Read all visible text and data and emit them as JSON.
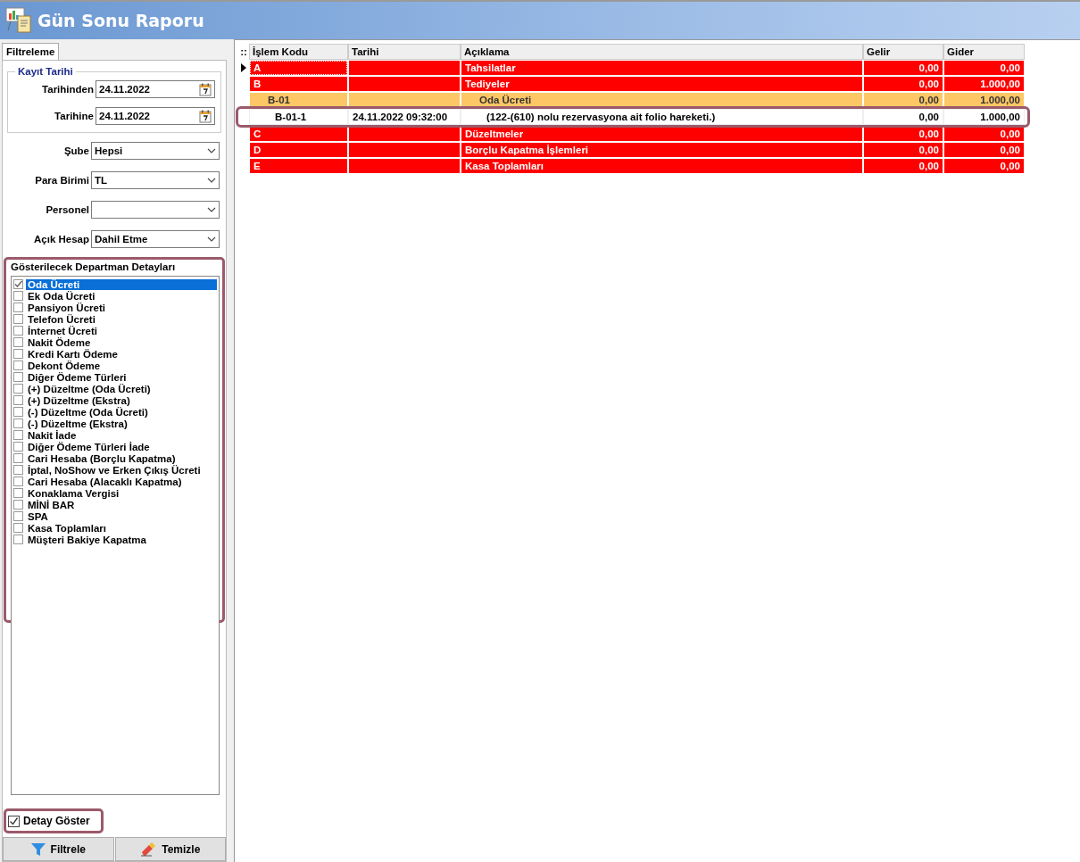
{
  "window": {
    "title": "Gün Sonu Raporu"
  },
  "filter_panel": {
    "tab": {
      "label": "Filtreleme",
      "selected": true
    },
    "date_group": {
      "title": "Kayıt Tarihi",
      "fields": [
        {
          "label": "Tarihinden",
          "value": "24.11.2022"
        },
        {
          "label": "Tarihine",
          "value": "24.11.2022"
        }
      ]
    },
    "dropdowns": [
      {
        "label": "Şube",
        "value": "Hepsi"
      },
      {
        "label": "Para Birimi",
        "value": "TL"
      },
      {
        "label": "Personel"
      },
      {
        "label": "Açık Hesap",
        "value": "Dahil Etme"
      }
    ],
    "department_list": {
      "title": "Gösterilecek Departman Detayları",
      "items": [
        {
          "label": "Oda Ücreti",
          "checked": true,
          "selected": true
        },
        {
          "label": "Ek Oda Ücreti",
          "checked": false,
          "selected": false
        },
        {
          "label": "Pansiyon Ücreti",
          "checked": false,
          "selected": false
        },
        {
          "label": "Telefon Ücreti",
          "checked": false,
          "selected": false
        },
        {
          "label": "İnternet Ücreti",
          "checked": false,
          "selected": false
        },
        {
          "label": "Nakit Ödeme",
          "checked": false,
          "selected": false
        },
        {
          "label": "Kredi Kartı Ödeme",
          "checked": false,
          "selected": false
        },
        {
          "label": "Dekont Ödeme",
          "checked": false,
          "selected": false
        },
        {
          "label": "Diğer Ödeme Türleri",
          "checked": false,
          "selected": false
        },
        {
          "label": "(+) Düzeltme (Oda Ücreti)",
          "checked": false,
          "selected": false
        },
        {
          "label": "(+) Düzeltme (Ekstra)",
          "checked": false,
          "selected": false
        },
        {
          "label": "(-) Düzeltme (Oda Ücreti)",
          "checked": false,
          "selected": false
        },
        {
          "label": "(-) Düzeltme (Ekstra)",
          "checked": false,
          "selected": false
        },
        {
          "label": "Nakit İade",
          "checked": false,
          "selected": false
        },
        {
          "label": "Diğer Ödeme Türleri İade",
          "checked": false,
          "selected": false
        },
        {
          "label": "Cari Hesaba (Borçlu Kapatma)",
          "checked": false,
          "selected": false
        },
        {
          "label": "İptal, NoShow ve Erken Çıkış Ücreti",
          "checked": false,
          "selected": false
        },
        {
          "label": "Cari Hesaba (Alacaklı Kapatma)",
          "checked": false,
          "selected": false
        },
        {
          "label": "Konaklama Vergisi",
          "checked": false,
          "selected": false
        },
        {
          "label": "MİNİ BAR",
          "checked": false,
          "selected": false
        },
        {
          "label": "SPA",
          "checked": false,
          "selected": false
        },
        {
          "label": "Kasa Toplamları",
          "checked": false,
          "selected": false
        },
        {
          "label": "Müşteri Bakiye Kapatma",
          "checked": false,
          "selected": false
        }
      ]
    },
    "show_detail": {
      "label": "Detay Göster",
      "checked": true
    },
    "buttons": [
      {
        "kind": "filter",
        "label": "Filtrele"
      },
      {
        "kind": "clear",
        "label": "Temizle"
      }
    ]
  },
  "table": {
    "grip": "::",
    "columns": [
      "İşlem Kodu",
      "Tarihi",
      "Açıklama",
      "Gelir",
      "Gider"
    ],
    "rows": [
      {
        "kind": "group",
        "selected": true,
        "code": "A",
        "date": "",
        "description": "Tahsilatlar",
        "income": "0,00",
        "expense": "0,00"
      },
      {
        "kind": "group",
        "selected": false,
        "code": "B",
        "date": "",
        "description": "Tediyeler",
        "income": "0,00",
        "expense": "1.000,00"
      },
      {
        "kind": "subgroup",
        "selected": false,
        "code": "B-01",
        "date": "",
        "description": "Oda Ücreti",
        "income": "0,00",
        "expense": "1.000,00"
      },
      {
        "kind": "detail",
        "selected": false,
        "code": "B-01-1",
        "date": "24.11.2022 09:32:00",
        "description": "(122-(610) nolu rezervasyona ait folio hareketi.)",
        "income": "0,00",
        "expense": "1.000,00"
      },
      {
        "kind": "group",
        "selected": false,
        "code": "C",
        "date": "",
        "description": "Düzeltmeler",
        "income": "0,00",
        "expense": "0,00"
      },
      {
        "kind": "group",
        "selected": false,
        "code": "D",
        "date": "",
        "description": "Borçlu Kapatma İşlemleri",
        "income": "0,00",
        "expense": "0,00"
      },
      {
        "kind": "group",
        "selected": false,
        "code": "E",
        "date": "",
        "description": "Kasa Toplamları",
        "income": "0,00",
        "expense": "0,00"
      }
    ]
  }
}
